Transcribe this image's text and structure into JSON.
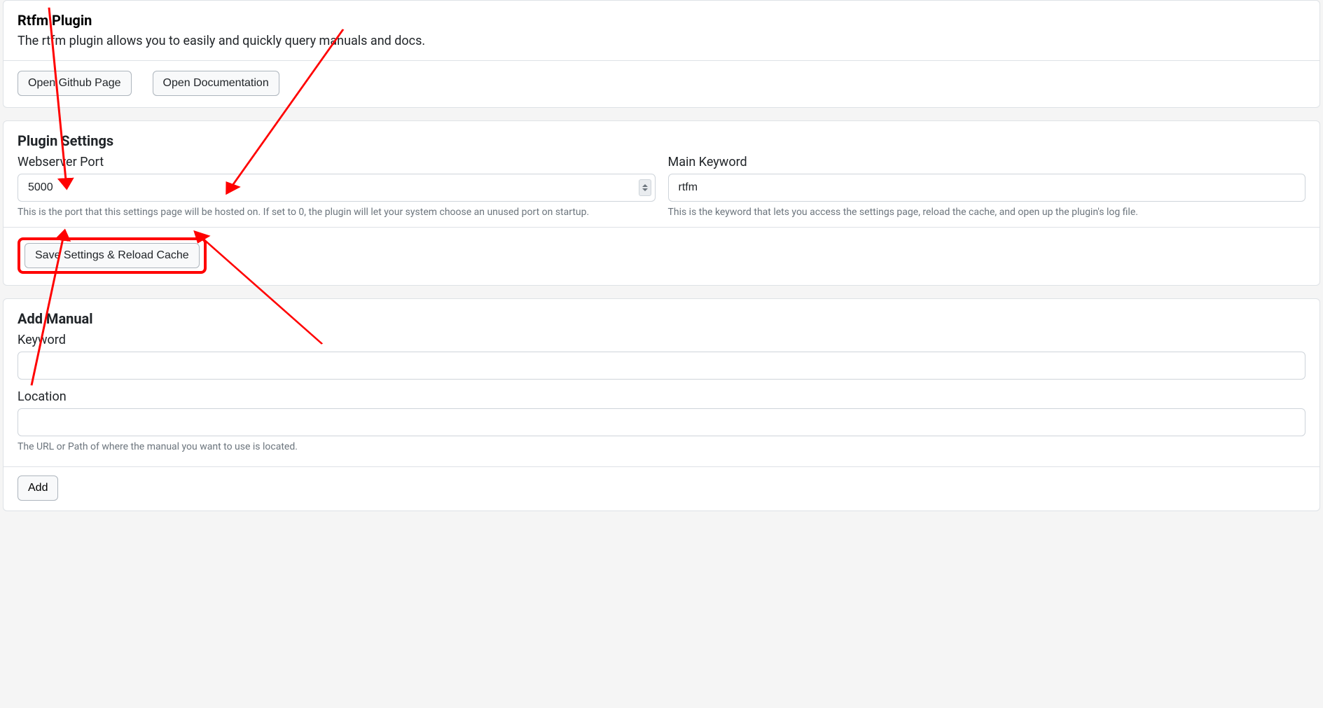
{
  "header": {
    "title": "Rtfm Plugin",
    "subtitle": "The rtfm plugin allows you to easily and quickly query manuals and docs.",
    "buttons": {
      "github": "Open Github Page",
      "docs": "Open Documentation"
    }
  },
  "settings": {
    "title": "Plugin Settings",
    "webserver_port": {
      "label": "Webserver Port",
      "value": "5000",
      "help": "This is the port that this settings page will be hosted on. If set to 0, the plugin will let your system choose an unused port on startup."
    },
    "main_keyword": {
      "label": "Main Keyword",
      "value": "rtfm",
      "help": "This is the keyword that lets you access the settings page, reload the cache, and open up the plugin's log file."
    },
    "save_button": "Save Settings & Reload Cache"
  },
  "add_manual": {
    "title": "Add Manual",
    "keyword": {
      "label": "Keyword",
      "value": ""
    },
    "location": {
      "label": "Location",
      "value": "",
      "help": "The URL or Path of where the manual you want to use is located."
    },
    "add_button": "Add"
  },
  "annotations": {
    "highlight_color": "#ff0000"
  }
}
